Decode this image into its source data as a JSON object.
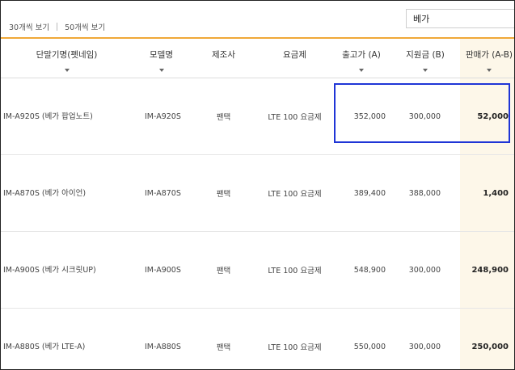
{
  "toolbar": {
    "page_size_30": "30개씩 보기",
    "page_size_50": "50개씩 보기",
    "search_value": "베가"
  },
  "table": {
    "headers": [
      "단말기명(펫네임)",
      "모델명",
      "제조사",
      "요금제",
      "출고가 (A)",
      "지원금 (B)",
      "판매가 (A-B)"
    ],
    "rows": [
      {
        "name": "IM-A920S (베가 팝업노트)",
        "model": "IM-A920S",
        "maker": "팬택",
        "plan": "LTE 100 요금제",
        "release_price": "352,000",
        "subsidy": "300,000",
        "sale_price": "52,000"
      },
      {
        "name": "IM-A870S (베가 아이언)",
        "model": "IM-A870S",
        "maker": "팬택",
        "plan": "LTE 100 요금제",
        "release_price": "389,400",
        "subsidy": "388,000",
        "sale_price": "1,400"
      },
      {
        "name": "IM-A900S (베가 시크릿UP)",
        "model": "IM-A900S",
        "maker": "팬택",
        "plan": "LTE 100 요금제",
        "release_price": "548,900",
        "subsidy": "300,000",
        "sale_price": "248,900"
      },
      {
        "name": "IM-A880S (베가 LTE-A)",
        "model": "IM-A880S",
        "maker": "팬택",
        "plan": "LTE 100 요금제",
        "release_price": "550,000",
        "subsidy": "300,000",
        "sale_price": "250,000"
      }
    ]
  },
  "colors": {
    "accent": "#f0a838",
    "sale_column_bg": "#fdf7e9",
    "highlight_box": "#1f35d6"
  },
  "icons": {
    "sort_arrow": "triangle-down"
  }
}
